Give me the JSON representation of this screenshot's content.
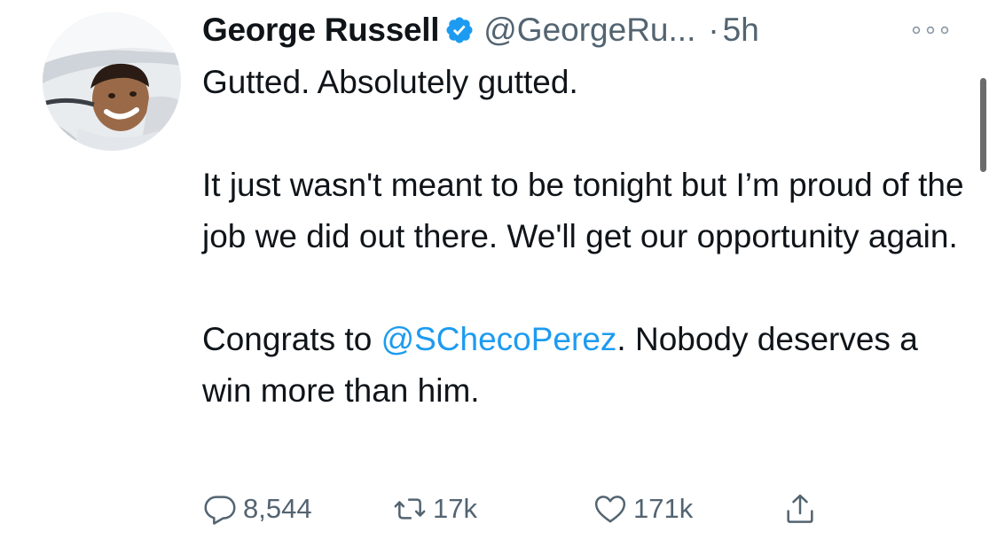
{
  "author": {
    "display_name": "George Russell",
    "handle": "@GeorgeRu...",
    "separator": "·",
    "time": "5h",
    "verified": true
  },
  "tweet": {
    "line1": "Gutted. Absolutely gutted.",
    "para2": "It just wasn't meant to be tonight but I’m proud of the job we did out there. We'll get our opportunity again.",
    "para3_prefix": "Congrats to ",
    "mention": "@SChecoPerez",
    "para3_suffix": ". Nobody deserves a win more than him."
  },
  "actions": {
    "replies": "8,544",
    "retweets": "17k",
    "likes": "171k"
  },
  "icons": {
    "reply": "reply-icon",
    "retweet": "retweet-icon",
    "like": "heart-icon",
    "share": "share-icon",
    "more": "more-icon",
    "verified": "verified-badge-icon"
  },
  "colors": {
    "text": "#0f1419",
    "secondary": "#536471",
    "accent": "#1d9bf0"
  }
}
